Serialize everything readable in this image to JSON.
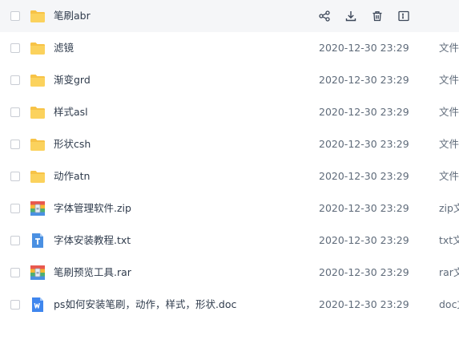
{
  "files": [
    {
      "name": "笔刷abr",
      "date": "",
      "type": "",
      "icon": "folder-icon",
      "hover": true
    },
    {
      "name": "滤镜",
      "date": "2020-12-30 23:29",
      "type": "文件",
      "icon": "folder-icon"
    },
    {
      "name": "渐变grd",
      "date": "2020-12-30 23:29",
      "type": "文件",
      "icon": "folder-icon"
    },
    {
      "name": "样式asl",
      "date": "2020-12-30 23:29",
      "type": "文件",
      "icon": "folder-icon"
    },
    {
      "name": "形状csh",
      "date": "2020-12-30 23:29",
      "type": "文件",
      "icon": "folder-icon"
    },
    {
      "name": "动作atn",
      "date": "2020-12-30 23:29",
      "type": "文件",
      "icon": "folder-icon"
    },
    {
      "name": "字体管理软件.zip",
      "date": "2020-12-30 23:29",
      "type": "zip文",
      "icon": "archive-icon"
    },
    {
      "name": "字体安装教程.txt",
      "date": "2020-12-30 23:29",
      "type": "txt文",
      "icon": "text-file-icon"
    },
    {
      "name": "笔刷预览工具.rar",
      "date": "2020-12-30 23:29",
      "type": "rar文",
      "icon": "archive-icon"
    },
    {
      "name": "ps如何安装笔刷，动作，样式，形状.doc",
      "date": "2020-12-30 23:29",
      "type": "doc文",
      "icon": "word-doc-icon"
    }
  ],
  "hover_actions": [
    "share-icon",
    "download-icon",
    "delete-icon",
    "rename-icon"
  ],
  "colors": {
    "folder": "#f7c347",
    "text_file": "#4a90e2",
    "word_doc": "#3f86ee",
    "archive_stripes": [
      "#e8584f",
      "#f7b731",
      "#4fb06f",
      "#4a90e2"
    ],
    "hover_row": "#f5f6f8"
  }
}
